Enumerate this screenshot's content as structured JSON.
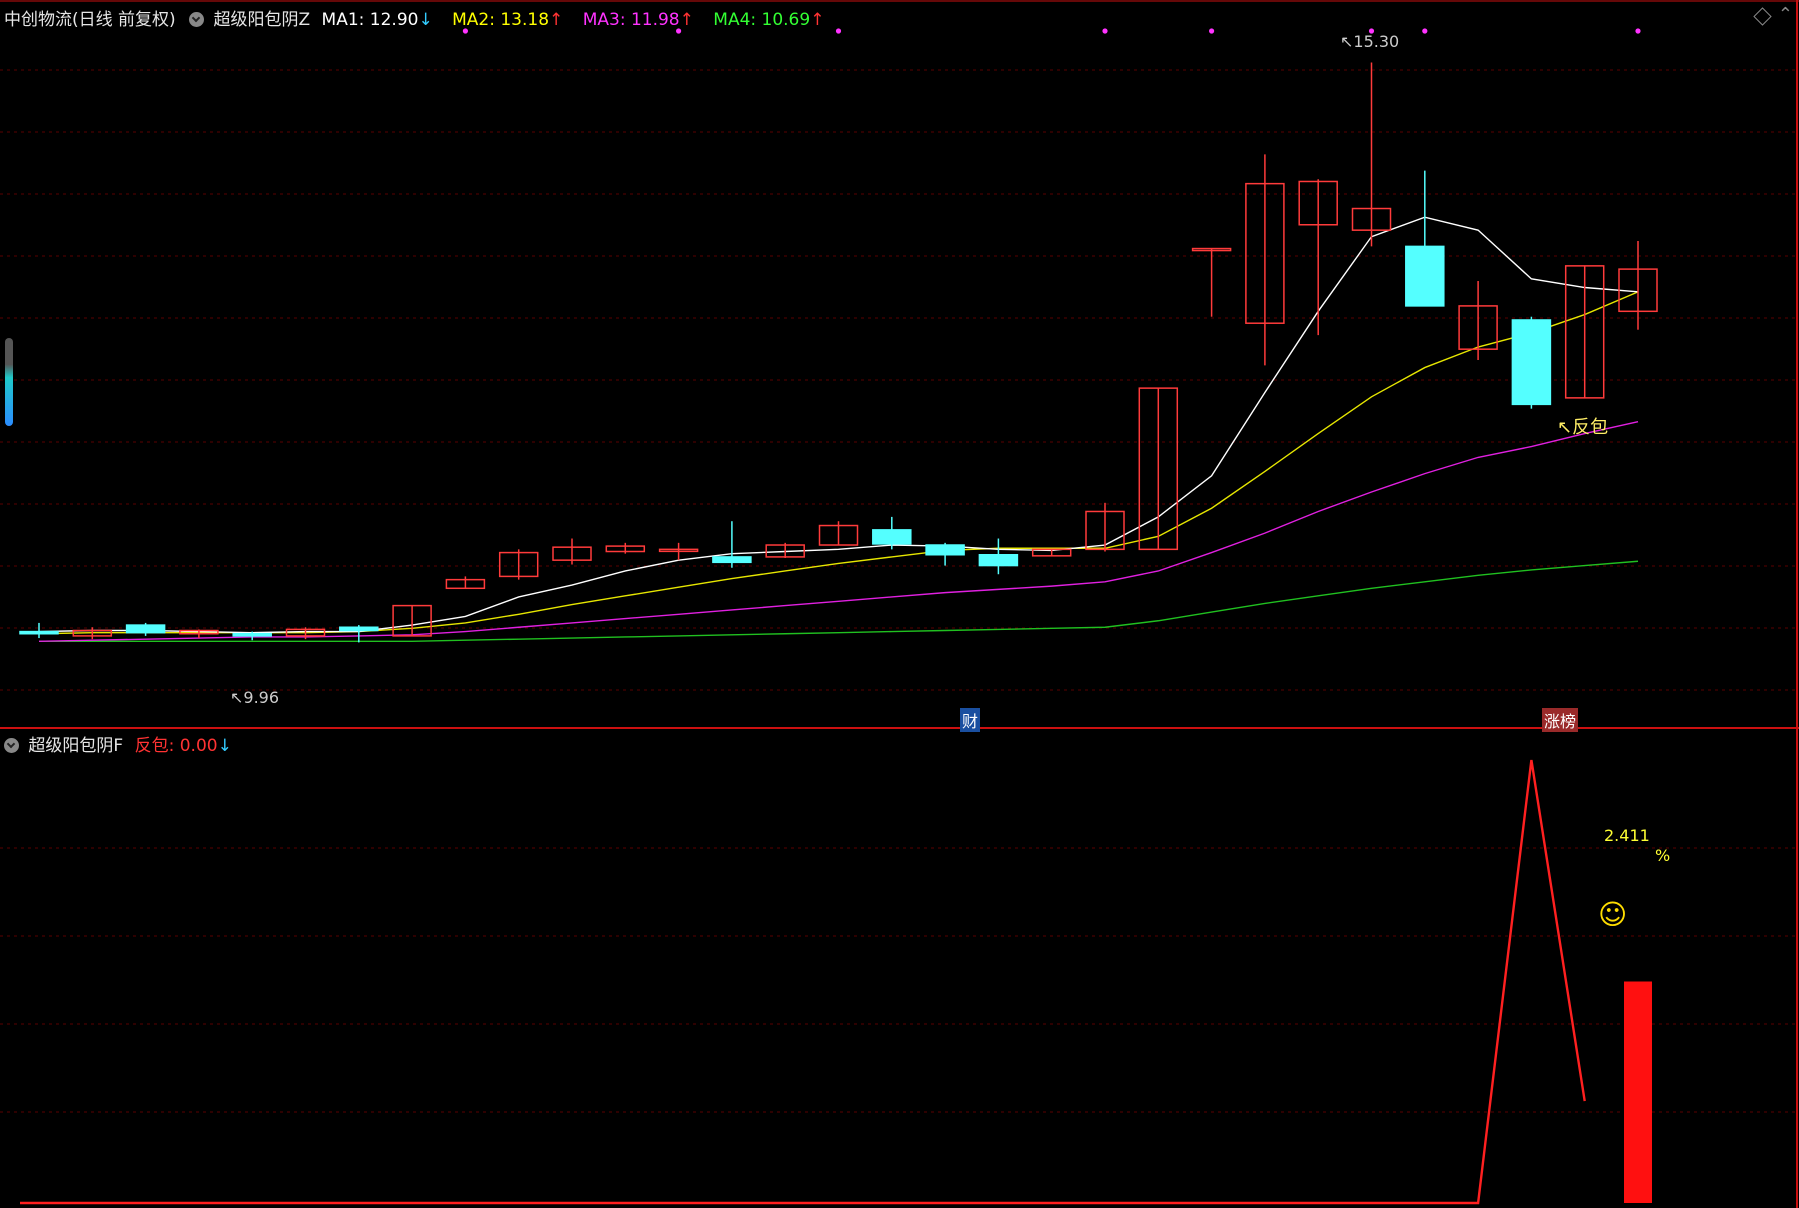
{
  "header": {
    "stock_name": "中创物流(日线 前复权)",
    "main_indicator": "超级阳包阴Z",
    "ma1": {
      "label": "MA1: 12.90",
      "arrow": "↓",
      "color": "#ffffff",
      "arrow_color": "#33ccff"
    },
    "ma2": {
      "label": "MA2: 13.18",
      "arrow": "↑",
      "color": "#ffff00",
      "arrow_color": "#ff3333"
    },
    "ma3": {
      "label": "MA3: 11.98",
      "arrow": "↑",
      "color": "#ff33ff",
      "arrow_color": "#ff3333"
    },
    "ma4": {
      "label": "MA4: 10.69",
      "arrow": "↑",
      "color": "#33ff33",
      "arrow_color": "#ff3333"
    }
  },
  "sub_header": {
    "indicator": "超级阳包阴F",
    "value_label": "反包: 0.00",
    "arrow": "↓"
  },
  "annotations": {
    "high_price": "15.30",
    "low_price": "9.96",
    "signal_label": "反包",
    "fin_badge": "财",
    "limit_badge": "涨榜",
    "sub_value": "2.411",
    "sub_unit": "%",
    "emoji": "☺"
  },
  "colors": {
    "up": "#ff3b3b",
    "down": "#54ffff",
    "grid": "#5a0000",
    "ma1": "#ffffff",
    "ma2": "#e6e600",
    "ma3": "#e020e0",
    "ma4": "#20c020"
  },
  "chart_data": {
    "type": "candlestick",
    "price_range": [
      9.5,
      15.6
    ],
    "candles": [
      {
        "o": 10.04,
        "h": 10.12,
        "l": 9.98,
        "c": 10.02
      },
      {
        "o": 10.0,
        "h": 10.08,
        "l": 9.97,
        "c": 10.05
      },
      {
        "o": 10.1,
        "h": 10.12,
        "l": 10.0,
        "c": 10.03
      },
      {
        "o": 10.02,
        "h": 10.06,
        "l": 9.98,
        "c": 10.05
      },
      {
        "o": 10.02,
        "h": 10.04,
        "l": 9.96,
        "c": 10.0
      },
      {
        "o": 10.0,
        "h": 10.08,
        "l": 9.97,
        "c": 10.06
      },
      {
        "o": 10.08,
        "h": 10.1,
        "l": 9.94,
        "c": 10.05
      },
      {
        "o": 10.0,
        "h": 10.28,
        "l": 10.0,
        "c": 10.28
      },
      {
        "o": 10.44,
        "h": 10.55,
        "l": 10.44,
        "c": 10.52
      },
      {
        "o": 10.55,
        "h": 10.8,
        "l": 10.52,
        "c": 10.77
      },
      {
        "o": 10.7,
        "h": 10.9,
        "l": 10.66,
        "c": 10.82
      },
      {
        "o": 10.78,
        "h": 10.86,
        "l": 10.76,
        "c": 10.83
      },
      {
        "o": 10.8,
        "h": 10.86,
        "l": 10.7,
        "c": 10.8
      },
      {
        "o": 10.73,
        "h": 11.06,
        "l": 10.63,
        "c": 10.68
      },
      {
        "o": 10.73,
        "h": 10.86,
        "l": 10.72,
        "c": 10.84
      },
      {
        "o": 10.84,
        "h": 11.06,
        "l": 10.84,
        "c": 11.02
      },
      {
        "o": 10.98,
        "h": 11.1,
        "l": 10.8,
        "c": 10.85
      },
      {
        "o": 10.84,
        "h": 10.86,
        "l": 10.65,
        "c": 10.75
      },
      {
        "o": 10.75,
        "h": 10.9,
        "l": 10.57,
        "c": 10.65
      },
      {
        "o": 10.74,
        "h": 10.8,
        "l": 10.74,
        "c": 10.8
      },
      {
        "o": 10.8,
        "h": 11.23,
        "l": 10.78,
        "c": 11.15
      },
      {
        "o": 10.8,
        "h": 12.29,
        "l": 10.8,
        "c": 12.29
      },
      {
        "o": 13.58,
        "h": 13.58,
        "l": 12.95,
        "c": 13.58
      },
      {
        "o": 12.89,
        "h": 14.45,
        "l": 12.5,
        "c": 14.18
      },
      {
        "o": 13.8,
        "h": 14.22,
        "l": 12.78,
        "c": 14.2
      },
      {
        "o": 13.75,
        "h": 15.3,
        "l": 13.6,
        "c": 13.95
      },
      {
        "o": 13.6,
        "h": 14.3,
        "l": 13.1,
        "c": 13.05
      },
      {
        "o": 12.65,
        "h": 13.28,
        "l": 12.55,
        "c": 13.05
      },
      {
        "o": 12.92,
        "h": 12.95,
        "l": 12.1,
        "c": 12.14
      },
      {
        "o": 12.2,
        "h": 13.42,
        "l": 12.2,
        "c": 13.42
      },
      {
        "o": 13.0,
        "h": 13.65,
        "l": 12.83,
        "c": 13.39
      }
    ],
    "ma1": [
      10.04,
      10.05,
      10.05,
      10.04,
      10.03,
      10.04,
      10.04,
      10.1,
      10.18,
      10.36,
      10.47,
      10.6,
      10.7,
      10.76,
      10.78,
      10.8,
      10.84,
      10.83,
      10.8,
      10.79,
      10.84,
      11.1,
      11.48,
      12.25,
      13.0,
      13.69,
      13.87,
      13.75,
      13.3,
      13.22,
      13.18
    ],
    "ma2": [
      10.02,
      10.03,
      10.03,
      10.03,
      10.03,
      10.03,
      10.04,
      10.07,
      10.12,
      10.2,
      10.29,
      10.37,
      10.45,
      10.53,
      10.6,
      10.67,
      10.73,
      10.79,
      10.81,
      10.81,
      10.81,
      10.92,
      11.18,
      11.52,
      11.87,
      12.21,
      12.48,
      12.67,
      12.8,
      12.97,
      13.18
    ],
    "ma3": [
      9.95,
      9.96,
      9.97,
      9.98,
      9.99,
      9.99,
      10.0,
      10.01,
      10.04,
      10.08,
      10.12,
      10.16,
      10.2,
      10.24,
      10.28,
      10.32,
      10.36,
      10.4,
      10.43,
      10.46,
      10.5,
      10.6,
      10.77,
      10.95,
      11.15,
      11.33,
      11.5,
      11.65,
      11.75,
      11.87,
      11.98
    ],
    "ma4": [
      9.95,
      9.95,
      9.95,
      9.95,
      9.95,
      9.95,
      9.95,
      9.95,
      9.96,
      9.97,
      9.98,
      9.99,
      10.0,
      10.01,
      10.02,
      10.03,
      10.04,
      10.05,
      10.06,
      10.07,
      10.08,
      10.14,
      10.22,
      10.3,
      10.37,
      10.44,
      10.5,
      10.56,
      10.61,
      10.65,
      10.69
    ],
    "signal_dots": [
      8,
      12,
      15,
      20,
      22,
      25,
      26,
      30
    ],
    "sub_chart": {
      "type": "line+bar",
      "line_values": [
        0,
        0,
        0,
        0,
        0,
        0,
        0,
        0,
        0,
        0,
        0,
        0,
        0,
        0,
        0,
        0,
        0,
        0,
        0,
        0,
        0,
        0,
        0,
        0,
        0,
        0,
        0,
        0,
        1.0,
        0.23
      ],
      "bar_index": 30,
      "bar_value": 0.5
    }
  }
}
